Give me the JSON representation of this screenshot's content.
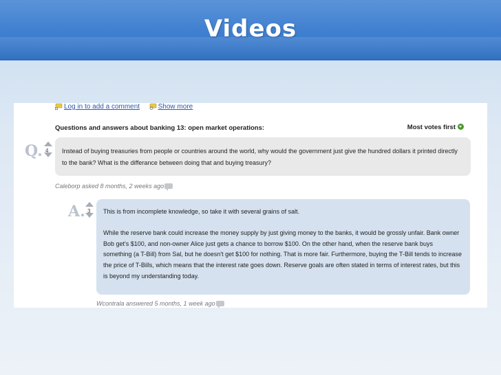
{
  "slide": {
    "title": "Videos"
  },
  "toolbar": {
    "login_comment_label": "Log in to add a comment",
    "show_more_label": "Show more"
  },
  "section": {
    "heading": "Questions and answers about banking 13: open market operations:",
    "sort_label": "Most votes first"
  },
  "question": {
    "marker": "Q.",
    "votes": "4",
    "text": "Instead of buying treasuries from people or countries around the world, why would the government just give the hundred dollars it printed directly to the bank? What is the differance between doing that and buying treasury?",
    "meta": "Caleborp asked 8 months, 2 weeks ago"
  },
  "answer": {
    "marker": "A.",
    "votes": "3",
    "paragraphs": [
      "This is from incomplete knowledge, so take it with several grains of salt.",
      "While the reserve bank could increase the money supply by just giving money to the banks, it would be grossly unfair. Bank owner Bob get's $100, and non-owner Alice just gets a chance to borrow $100. On the other hand, when the reserve bank buys something (a T-Bill) from Sal, but he doesn't get $100 for nothing. That is more fair. Furthermore, buying the T-Bill tends to increase the price of T-Bills, which means that the interest rate goes down. Reserve goals are often stated in terms of interest rates, but this is beyond my understanding today."
    ],
    "meta": "Wcontrala answered 5 months, 1 week ago"
  },
  "colors": {
    "header_blue": "#3f7fd0",
    "question_bg": "#e9e9e9",
    "answer_bg": "#d5e1ef",
    "link": "#2b55a8"
  }
}
